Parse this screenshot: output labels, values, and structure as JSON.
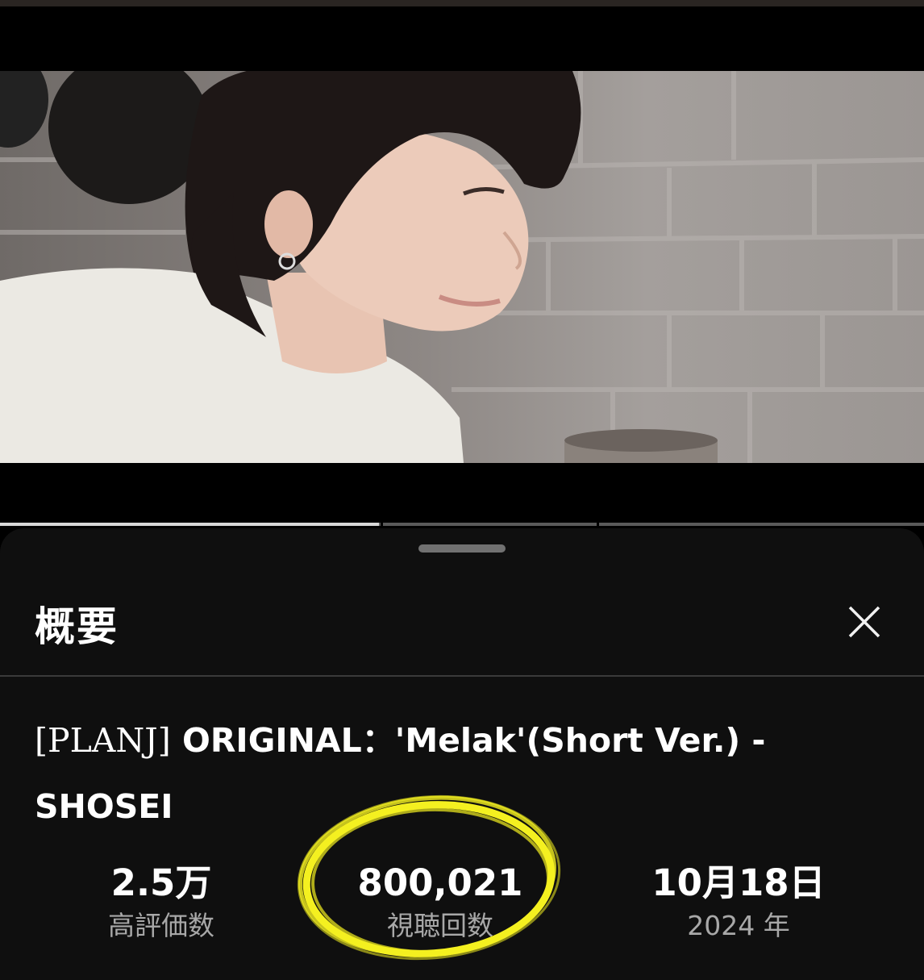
{
  "panel": {
    "title": "概要"
  },
  "video": {
    "title_prefix": "[PLANJ]",
    "title_rest": " ORIGINAL：'Melak'(Short Ver.) - SHOSEI",
    "progress_percent": 41
  },
  "stats": {
    "likes_value": "2.5万",
    "likes_label": "高評価数",
    "views_value": "800,021",
    "views_label": "視聴回数",
    "date_value": "10月18日",
    "date_year": "2024 年"
  },
  "icons": {
    "close": "close-icon",
    "grabber": "drag-handle"
  },
  "colors": {
    "sheet_bg": "#0f0f0f",
    "highlight": "#f4f020",
    "label_gray": "#a8a8a8"
  }
}
